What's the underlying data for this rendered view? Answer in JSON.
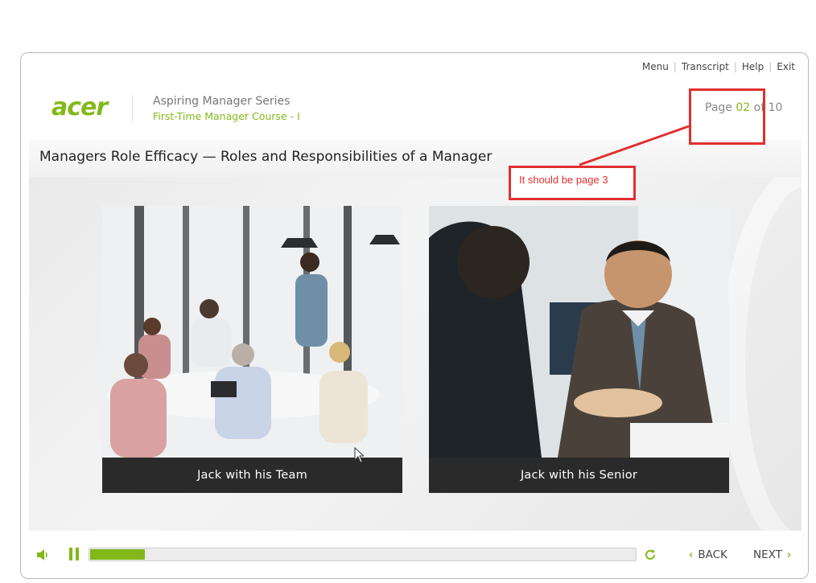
{
  "top_links": [
    "Menu",
    "Transcript",
    "Help",
    "Exit"
  ],
  "brand": {
    "logo": "acer",
    "series": "Aspiring Manager Series",
    "course": "First-Time Manager Course - I"
  },
  "page_info": {
    "label": "Page",
    "current": "02",
    "of": "of",
    "total": "10"
  },
  "title": "Managers Role Efficacy — Roles and Responsibilities of a Manager",
  "cards": [
    {
      "caption": "Jack with his Team"
    },
    {
      "caption": "Jack with his Senior"
    }
  ],
  "footer": {
    "progress": 0.1,
    "back_label": "BACK",
    "next_label": "NEXT"
  },
  "annotation": {
    "text": "It should be page 3"
  },
  "colors": {
    "accent": "#83b81a",
    "annotation": "#e03030"
  },
  "icons": [
    "volume-icon",
    "pause-icon",
    "refresh-icon",
    "chevron-left-icon",
    "chevron-right-icon",
    "mouse-cursor-icon"
  ]
}
